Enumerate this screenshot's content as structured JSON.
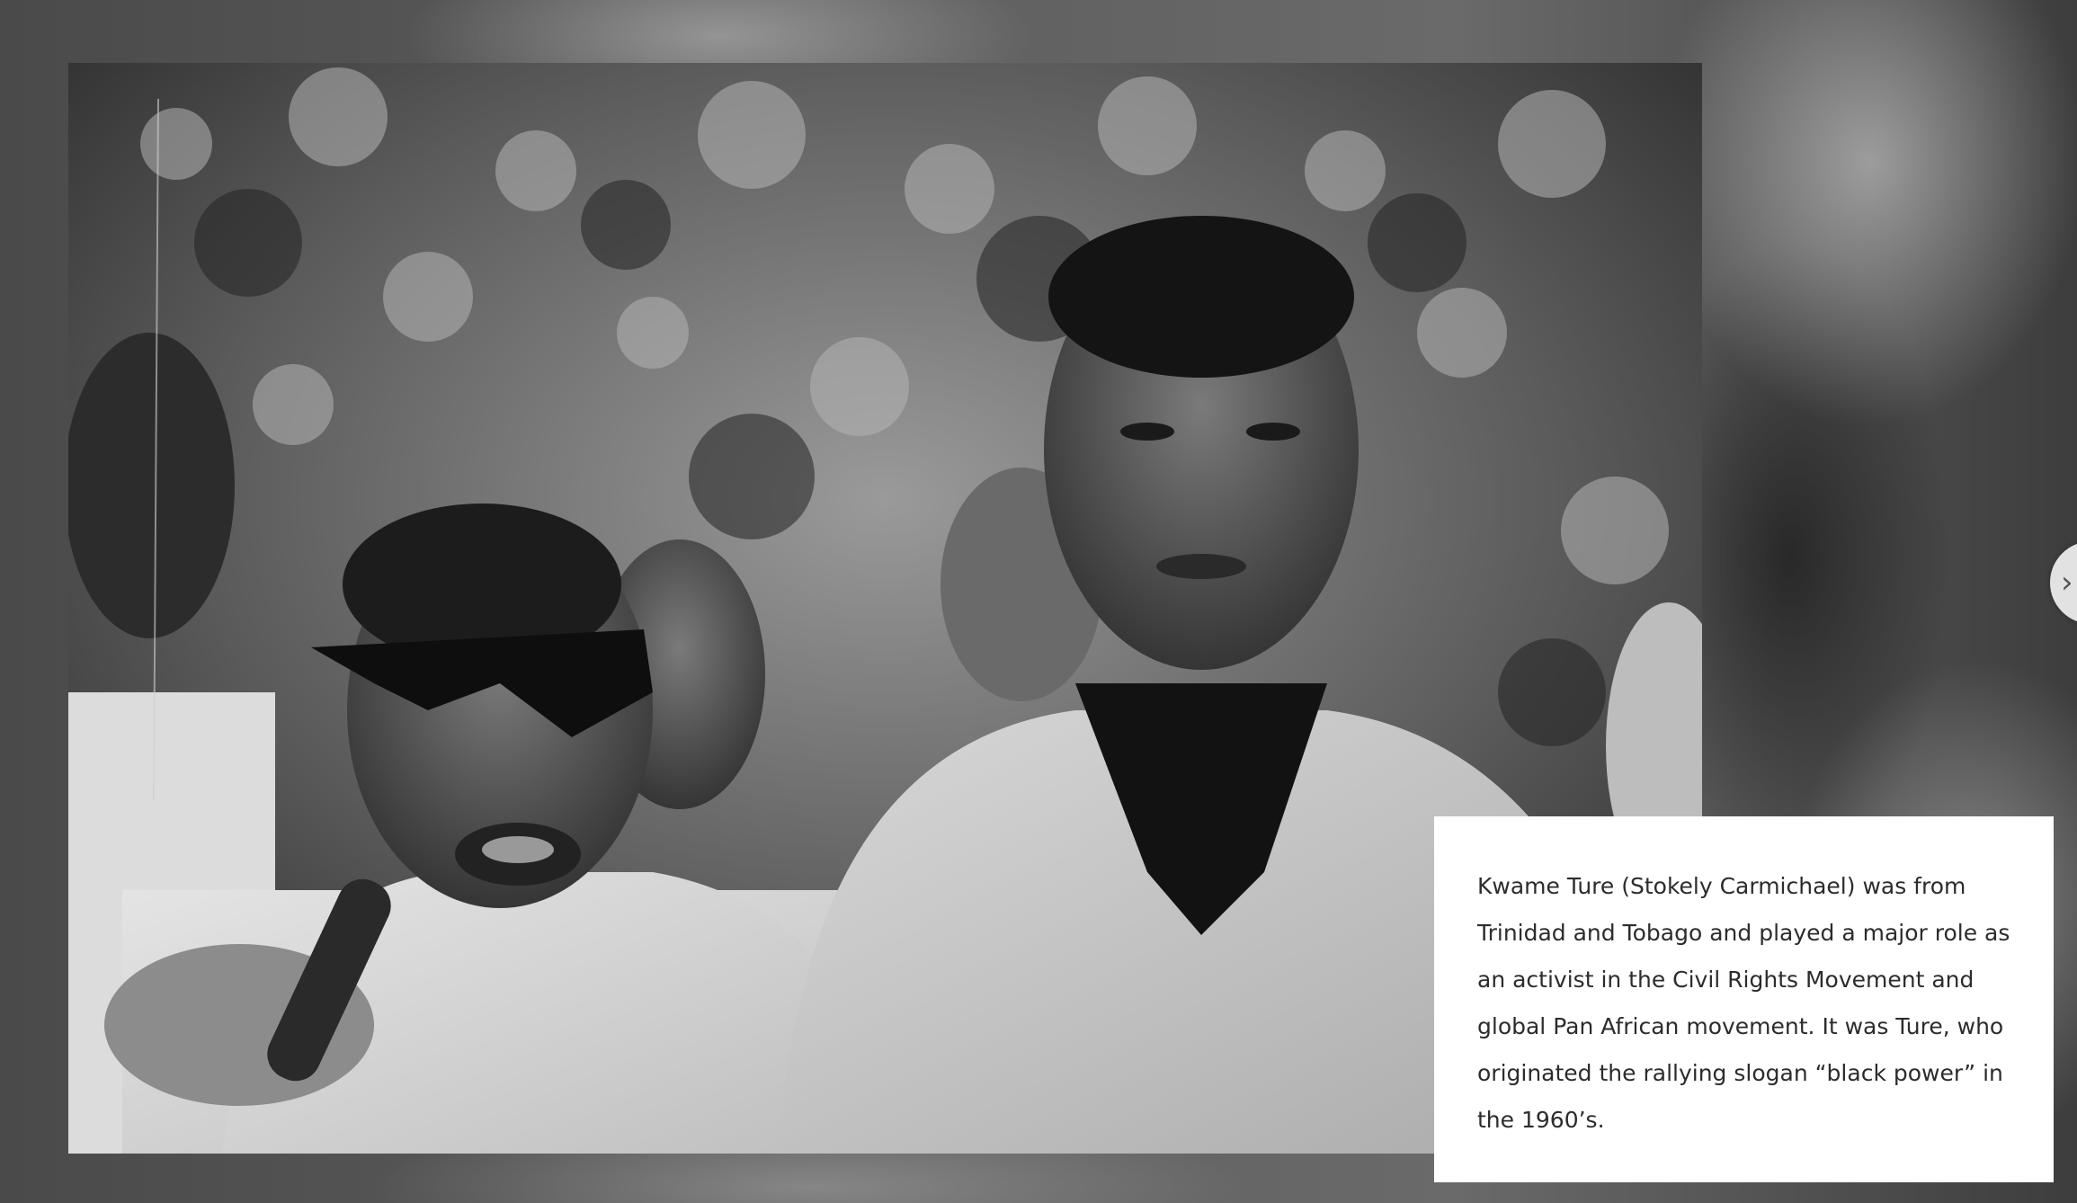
{
  "caption": {
    "text": "Kwame Ture (Stokely Carmichael) was from Trinidad and Tobago and played a major role as an activist in the Civil Rights Movement and global Pan African movement. It was Ture, who originated the rallying slogan “black power” in the 1960’s."
  },
  "photo": {
    "description_icon": "photograph"
  },
  "controls": {
    "edge_button_icon": "chevron-right-icon",
    "edge_button_glyph": "›"
  },
  "colors": {
    "card_background": "#ffffff",
    "caption_text": "#2c2c2c"
  }
}
